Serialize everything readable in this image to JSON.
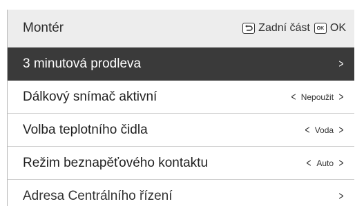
{
  "header": {
    "title": "Montér",
    "back_label": "Zadní část",
    "ok_icon_text": "OK",
    "ok_label": "OK"
  },
  "menu": {
    "items": [
      {
        "label": "3 minutová prodleva",
        "value": "",
        "selected": true
      },
      {
        "label": "Dálkový snímač aktivní",
        "value": "Nepoužit",
        "selected": false
      },
      {
        "label": "Volba teplotního čidla",
        "value": "Voda",
        "selected": false
      },
      {
        "label": "Režim beznapěťového kontaktu",
        "value": "Auto",
        "selected": false
      },
      {
        "label": "Adresa Centrálního řízení",
        "value": "",
        "selected": false
      }
    ],
    "prev_glyph": "<",
    "next_glyph": ">"
  },
  "colors": {
    "header_bg": "#ededed",
    "selected_bg": "#3a3a3a",
    "divider": "#cfcfcf"
  }
}
